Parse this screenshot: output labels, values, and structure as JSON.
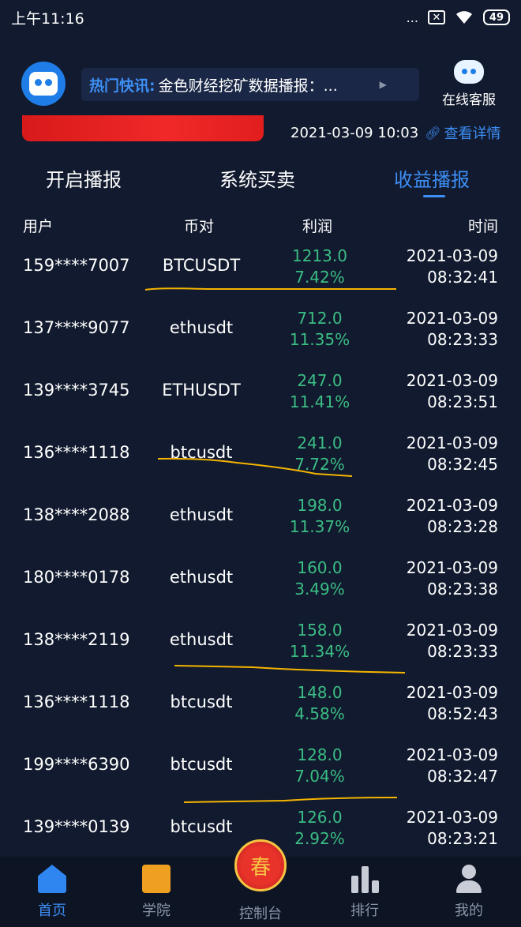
{
  "status_bar": {
    "time": "上午11:16",
    "signal": "...",
    "sim_x": "✕",
    "wifi": "WiFi",
    "battery": "49"
  },
  "header": {
    "news_label": "热门快讯:",
    "news_text": "金色财经挖矿数据播报：...",
    "service_label": "在线客服"
  },
  "info_row": {
    "datetime": "2021-03-09 10:03",
    "detail_link": "查看详情"
  },
  "tabs": [
    {
      "label": "开启播报",
      "active": false
    },
    {
      "label": "系统买卖",
      "active": false
    },
    {
      "label": "收益播报",
      "active": true
    }
  ],
  "columns": {
    "user": "用户",
    "pair": "币对",
    "profit": "利润",
    "time": "时间"
  },
  "rows": [
    {
      "user": "159****7007",
      "pair": "BTCUSDT",
      "profit": "1213.0",
      "pct": "7.42%",
      "date": "2021-03-09",
      "clock": "08:32:41"
    },
    {
      "user": "137****9077",
      "pair": "ethusdt",
      "profit": "712.0",
      "pct": "11.35%",
      "date": "2021-03-09",
      "clock": "08:23:33"
    },
    {
      "user": "139****3745",
      "pair": "ETHUSDT",
      "profit": "247.0",
      "pct": "11.41%",
      "date": "2021-03-09",
      "clock": "08:23:51"
    },
    {
      "user": "136****1118",
      "pair": "btcusdt",
      "profit": "241.0",
      "pct": "7.72%",
      "date": "2021-03-09",
      "clock": "08:32:45"
    },
    {
      "user": "138****2088",
      "pair": "ethusdt",
      "profit": "198.0",
      "pct": "11.37%",
      "date": "2021-03-09",
      "clock": "08:23:28"
    },
    {
      "user": "180****0178",
      "pair": "ethusdt",
      "profit": "160.0",
      "pct": "3.49%",
      "date": "2021-03-09",
      "clock": "08:23:38"
    },
    {
      "user": "138****2119",
      "pair": "ethusdt",
      "profit": "158.0",
      "pct": "11.34%",
      "date": "2021-03-09",
      "clock": "08:23:33"
    },
    {
      "user": "136****1118",
      "pair": "btcusdt",
      "profit": "148.0",
      "pct": "4.58%",
      "date": "2021-03-09",
      "clock": "08:52:43"
    },
    {
      "user": "199****6390",
      "pair": "btcusdt",
      "profit": "128.0",
      "pct": "7.04%",
      "date": "2021-03-09",
      "clock": "08:32:47"
    },
    {
      "user": "139****0139",
      "pair": "btcusdt",
      "profit": "126.0",
      "pct": "2.92%",
      "date": "2021-03-09",
      "clock": "08:23:21"
    }
  ],
  "bottom_nav": {
    "home": "首页",
    "academy": "学院",
    "console": "控制台",
    "console_glyph": "春",
    "rank": "排行",
    "me": "我的"
  },
  "colors": {
    "background": "#111a2e",
    "accent": "#3d8ef5",
    "profit_green": "#3bbd84",
    "annotation": "#f5b400"
  }
}
